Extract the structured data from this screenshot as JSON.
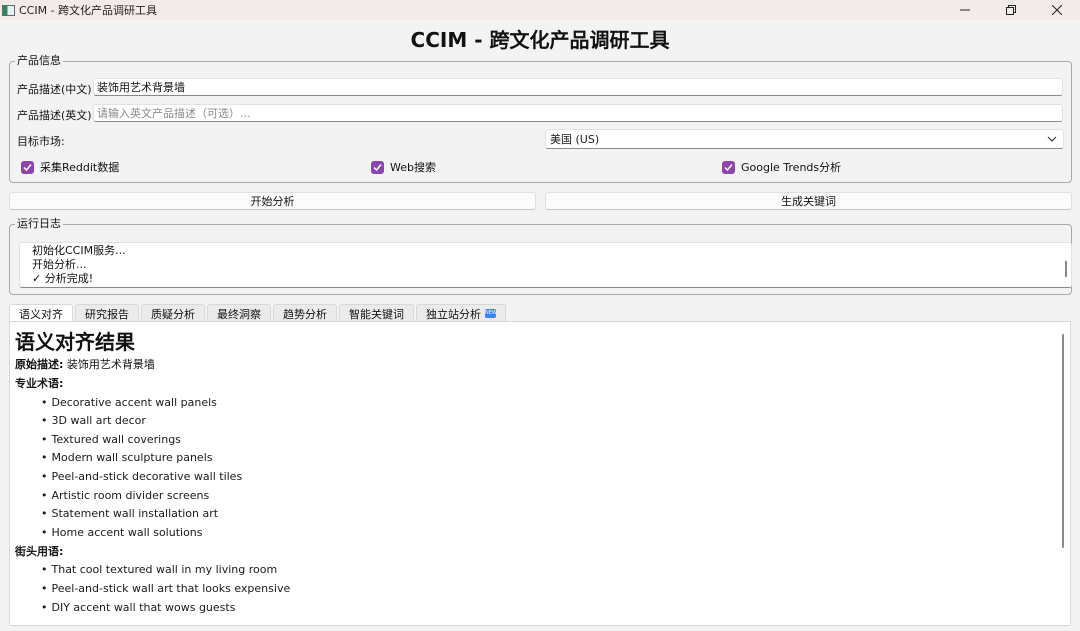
{
  "window": {
    "title": "CCIM - 跨文化产品调研工具"
  },
  "heading": "CCIM - 跨文化产品调研工具",
  "product_info": {
    "legend": "产品信息",
    "desc_cn_label": "产品描述(中文):",
    "desc_cn_value": "装饰用艺术背景墙",
    "desc_en_label": "产品描述(英文):",
    "desc_en_placeholder": "请输入英文产品描述（可选）...",
    "market_label": "目标市场:",
    "market_value": "美国 (US)",
    "options": [
      {
        "label": "采集Reddit数据",
        "checked": true
      },
      {
        "label": "Web搜索",
        "checked": true
      },
      {
        "label": "Google Trends分析",
        "checked": true
      }
    ]
  },
  "actions": {
    "start": "开始分析",
    "keywords": "生成关键词"
  },
  "log": {
    "legend": "运行日志",
    "lines": [
      "初始化CCIM服务...",
      "开始分析...",
      "✓ 分析完成!"
    ]
  },
  "tabs": [
    {
      "label": "语义对齐",
      "active": true
    },
    {
      "label": "研究报告",
      "active": false
    },
    {
      "label": "质疑分析",
      "active": false
    },
    {
      "label": "最终洞察",
      "active": false
    },
    {
      "label": "趋势分析",
      "active": false
    },
    {
      "label": "智能关键词",
      "active": false
    },
    {
      "label": "独立站分析",
      "active": false,
      "badge": "NEW"
    }
  ],
  "result": {
    "title": "语义对齐结果",
    "original_label": "原始描述:",
    "original_value": "装饰用艺术背景墙",
    "pro_terms_heading": "专业术语:",
    "pro_terms": [
      "Decorative accent wall panels",
      "3D wall art decor",
      "Textured wall coverings",
      "Modern wall sculpture panels",
      "Peel-and-stick decorative wall tiles",
      "Artistic room divider screens",
      "Statement wall installation art",
      "Home accent wall solutions"
    ],
    "street_heading": "街头用语:",
    "street_terms": [
      "That cool textured wall in my living room",
      "Peel-and-stick wall art that looks expensive",
      "DIY accent wall that wows guests"
    ]
  }
}
